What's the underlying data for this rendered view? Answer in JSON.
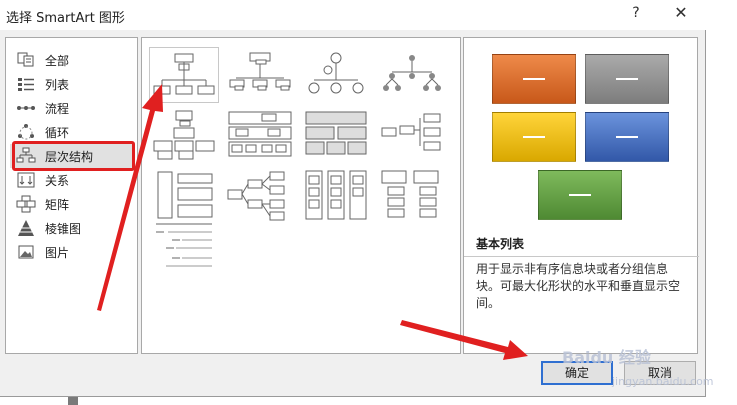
{
  "dialog": {
    "title": "选择 SmartArt 图形",
    "help_label": "?",
    "close_label": "✕"
  },
  "categories": [
    {
      "label": "全部",
      "icon": "all-icon"
    },
    {
      "label": "列表",
      "icon": "list-icon"
    },
    {
      "label": "流程",
      "icon": "process-icon"
    },
    {
      "label": "循环",
      "icon": "cycle-icon"
    },
    {
      "label": "层次结构",
      "icon": "hierarchy-icon",
      "selected": true
    },
    {
      "label": "关系",
      "icon": "relationship-icon"
    },
    {
      "label": "矩阵",
      "icon": "matrix-icon"
    },
    {
      "label": "棱锥图",
      "icon": "pyramid-icon"
    },
    {
      "label": "图片",
      "icon": "picture-icon"
    }
  ],
  "gallery": {
    "selected_index": 0,
    "count": 13
  },
  "preview": {
    "title": "基本列表",
    "description": "用于显示非有序信息块或者分组信息块。可最大化形状的水平和垂直显示空间。",
    "block_label": "—",
    "colors": {
      "orange": "#d9661f",
      "gray": "#8c8c8c",
      "gold": "#e6b400",
      "blue": "#3a65b8",
      "green": "#5e9a3e"
    }
  },
  "buttons": {
    "ok_label": "确定",
    "cancel_label": "取消"
  },
  "watermark": {
    "brand": "Baidu 经验",
    "domain": "jingyan.baidu.com"
  },
  "colors": {
    "annotation_red": "#e02020",
    "focus_blue": "#2f6fd1"
  }
}
